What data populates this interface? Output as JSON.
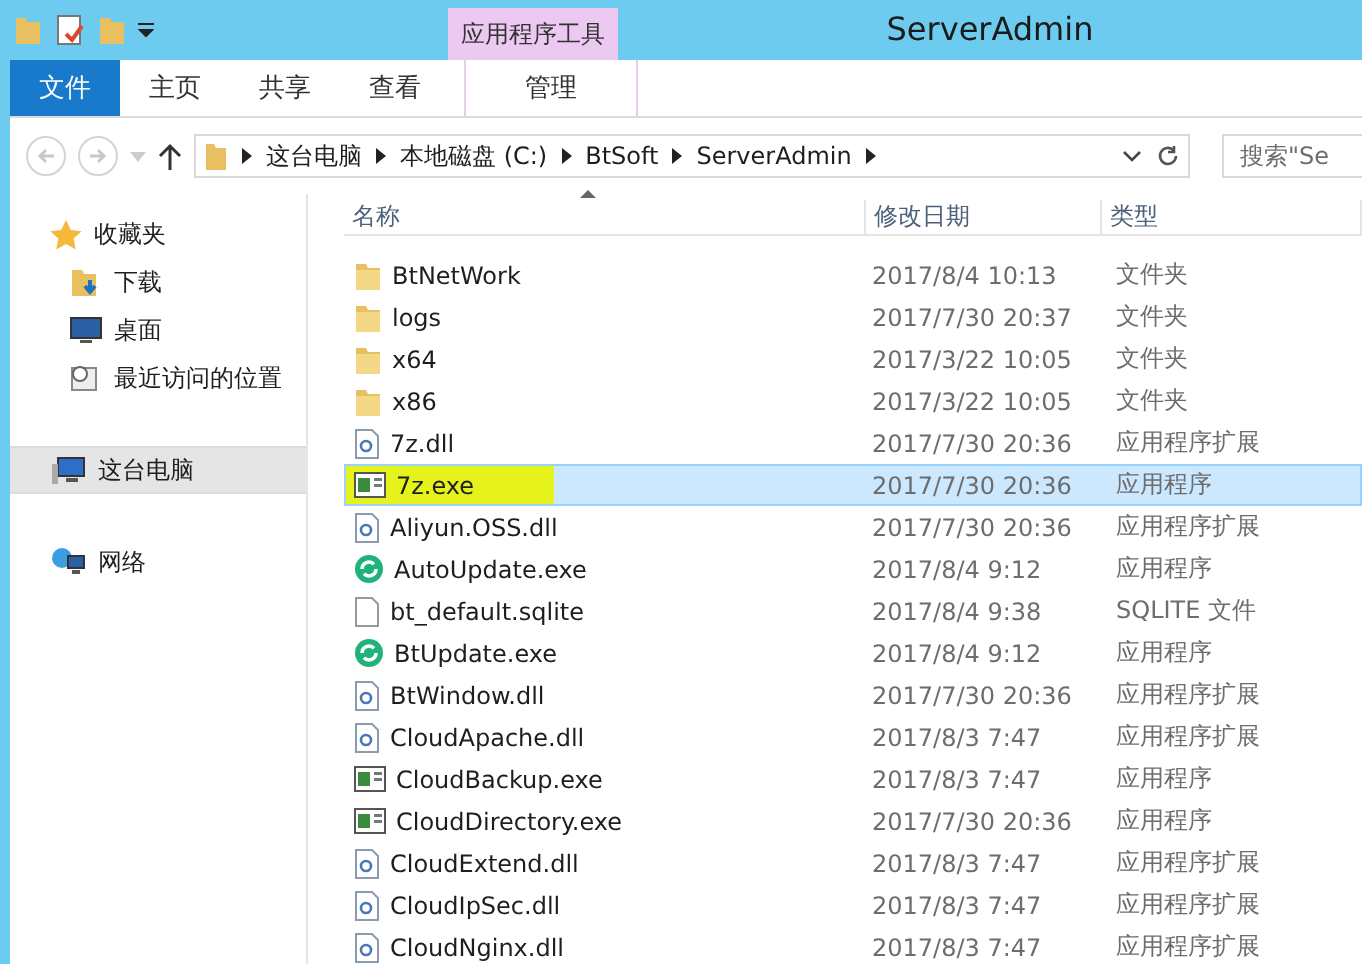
{
  "window": {
    "title": "ServerAdmin",
    "context_tab_group": "应用程序工具"
  },
  "ribbon_tabs": [
    {
      "label": "文件",
      "kind": "file"
    },
    {
      "label": "主页",
      "kind": "tab"
    },
    {
      "label": "共享",
      "kind": "tab"
    },
    {
      "label": "查看",
      "kind": "tab"
    },
    {
      "label": "管理",
      "kind": "context"
    }
  ],
  "address": {
    "crumbs": [
      "这台电脑",
      "本地磁盘 (C:)",
      "BtSoft",
      "ServerAdmin"
    ]
  },
  "search": {
    "placeholder": "搜索\"Se"
  },
  "sidebar": {
    "groups": [
      {
        "label": "收藏夹",
        "kind": "favorites",
        "selected": false,
        "children": [
          {
            "label": "下载",
            "kind": "downloads",
            "selected": false
          },
          {
            "label": "桌面",
            "kind": "desktop",
            "selected": false
          },
          {
            "label": "最近访问的位置",
            "kind": "recent",
            "selected": false
          }
        ]
      },
      {
        "label": "这台电脑",
        "kind": "computer",
        "selected": true
      },
      {
        "label": "网络",
        "kind": "network",
        "selected": false
      }
    ]
  },
  "table": {
    "columns": [
      "名称",
      "修改日期",
      "类型"
    ],
    "rows": [
      {
        "name": "BtNetWork",
        "date": "2017/8/4 10:13",
        "type": "文件夹",
        "kind": "folder",
        "selected": false,
        "highlighted": false
      },
      {
        "name": "logs",
        "date": "2017/7/30 20:37",
        "type": "文件夹",
        "kind": "folder",
        "selected": false,
        "highlighted": false
      },
      {
        "name": "x64",
        "date": "2017/3/22 10:05",
        "type": "文件夹",
        "kind": "folder",
        "selected": false,
        "highlighted": false
      },
      {
        "name": "x86",
        "date": "2017/3/22 10:05",
        "type": "文件夹",
        "kind": "folder",
        "selected": false,
        "highlighted": false
      },
      {
        "name": "7z.dll",
        "date": "2017/7/30 20:36",
        "type": "应用程序扩展",
        "kind": "dll",
        "selected": false,
        "highlighted": false
      },
      {
        "name": "7z.exe",
        "date": "2017/7/30 20:36",
        "type": "应用程序",
        "kind": "exe",
        "selected": true,
        "highlighted": true
      },
      {
        "name": "Aliyun.OSS.dll",
        "date": "2017/7/30 20:36",
        "type": "应用程序扩展",
        "kind": "dll",
        "selected": false,
        "highlighted": false
      },
      {
        "name": "AutoUpdate.exe",
        "date": "2017/8/4 9:12",
        "type": "应用程序",
        "kind": "update",
        "selected": false,
        "highlighted": false
      },
      {
        "name": "bt_default.sqlite",
        "date": "2017/8/4 9:38",
        "type": "SQLITE 文件",
        "kind": "file",
        "selected": false,
        "highlighted": false
      },
      {
        "name": "BtUpdate.exe",
        "date": "2017/8/4 9:12",
        "type": "应用程序",
        "kind": "update",
        "selected": false,
        "highlighted": false
      },
      {
        "name": "BtWindow.dll",
        "date": "2017/7/30 20:36",
        "type": "应用程序扩展",
        "kind": "dll",
        "selected": false,
        "highlighted": false
      },
      {
        "name": "CloudApache.dll",
        "date": "2017/8/3 7:47",
        "type": "应用程序扩展",
        "kind": "dll",
        "selected": false,
        "highlighted": false
      },
      {
        "name": "CloudBackup.exe",
        "date": "2017/8/3 7:47",
        "type": "应用程序",
        "kind": "exe",
        "selected": false,
        "highlighted": false
      },
      {
        "name": "CloudDirectory.exe",
        "date": "2017/7/30 20:36",
        "type": "应用程序",
        "kind": "exe",
        "selected": false,
        "highlighted": false
      },
      {
        "name": "CloudExtend.dll",
        "date": "2017/8/3 7:47",
        "type": "应用程序扩展",
        "kind": "dll",
        "selected": false,
        "highlighted": false
      },
      {
        "name": "CloudIpSec.dll",
        "date": "2017/8/3 7:47",
        "type": "应用程序扩展",
        "kind": "dll",
        "selected": false,
        "highlighted": false
      },
      {
        "name": "CloudNginx.dll",
        "date": "2017/8/3 7:47",
        "type": "应用程序扩展",
        "kind": "dll",
        "selected": false,
        "highlighted": false
      }
    ]
  }
}
